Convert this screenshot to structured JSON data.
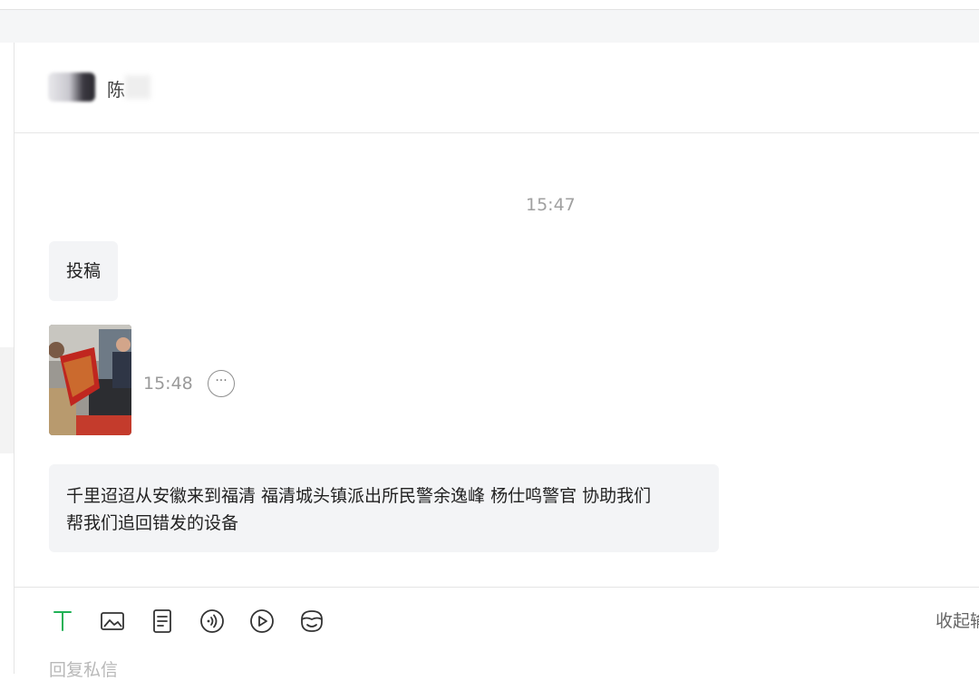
{
  "conversation": {
    "contact_name": "陈"
  },
  "messages": [
    {
      "type": "timestamp",
      "text": "15:47"
    },
    {
      "type": "text",
      "text": "投稿"
    },
    {
      "type": "image",
      "time": "15:48"
    },
    {
      "type": "text",
      "text_line1": "千里迢迢从安徽来到福清 福清城头镇派出所民警余逸峰 杨仕鸣警官 协助我们",
      "text_line2": "帮我们追回错发的设备"
    }
  ],
  "toolbar": {
    "tools": [
      "text-icon",
      "image-icon",
      "document-icon",
      "voice-icon",
      "video-icon",
      "emoji-icon"
    ],
    "collapse_label": "收起输",
    "reply_placeholder": "回复私信"
  },
  "colors": {
    "accent": "#1fb155",
    "bubble": "#f3f4f6",
    "timestamp": "#a0a0a0"
  }
}
